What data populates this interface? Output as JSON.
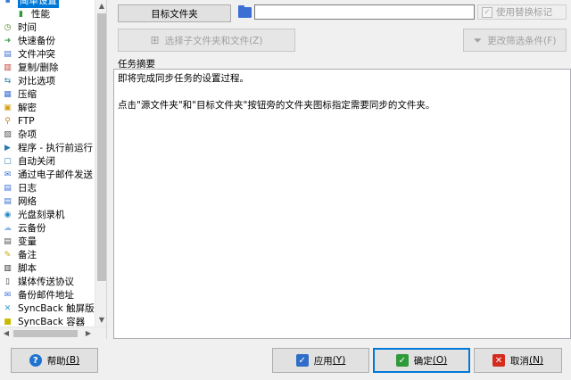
{
  "sidebar": {
    "items": [
      {
        "label": "简单设置",
        "icon": "settings-icon",
        "color": "#3a7bd5",
        "glyph": "▪",
        "selected": true,
        "sub": false
      },
      {
        "label": "性能",
        "icon": "bar-chart-icon",
        "color": "#2e9a3a",
        "glyph": "▮",
        "selected": false,
        "sub": true
      },
      {
        "label": "时间",
        "icon": "time-icon",
        "color": "#4a8a2a",
        "glyph": "◷",
        "selected": false,
        "sub": false
      },
      {
        "label": "快速备份",
        "icon": "fast-backup-icon",
        "color": "#3aa04a",
        "glyph": "➜",
        "selected": false,
        "sub": false
      },
      {
        "label": "文件冲突",
        "icon": "file-conflict-icon",
        "color": "#3b6fd6",
        "glyph": "▤",
        "selected": false,
        "sub": false
      },
      {
        "label": "复制/删除",
        "icon": "copy-delete-icon",
        "color": "#c0392b",
        "glyph": "▥",
        "selected": false,
        "sub": false
      },
      {
        "label": "对比选项",
        "icon": "compare-icon",
        "color": "#2a7ab0",
        "glyph": "⇆",
        "selected": false,
        "sub": false
      },
      {
        "label": "压缩",
        "icon": "compress-icon",
        "color": "#3b6fd6",
        "glyph": "▦",
        "selected": false,
        "sub": false
      },
      {
        "label": "解密",
        "icon": "lock-icon",
        "color": "#d4a017",
        "glyph": "▣",
        "selected": false,
        "sub": false
      },
      {
        "label": "FTP",
        "icon": "ftp-icon",
        "color": "#c77d14",
        "glyph": "⚲",
        "selected": false,
        "sub": false
      },
      {
        "label": "杂项",
        "icon": "misc-icon",
        "color": "#555555",
        "glyph": "▧",
        "selected": false,
        "sub": false
      },
      {
        "label": "程序 - 执行前运行",
        "icon": "program-run-icon",
        "color": "#2a7ab0",
        "glyph": "▶",
        "selected": false,
        "sub": false
      },
      {
        "label": "自动关闭",
        "icon": "auto-close-icon",
        "color": "#2a7ab0",
        "glyph": "▢",
        "selected": false,
        "sub": false
      },
      {
        "label": "通过电子邮件发送",
        "icon": "email-icon",
        "color": "#3b6fd6",
        "glyph": "✉",
        "selected": false,
        "sub": false
      },
      {
        "label": "日志",
        "icon": "log-icon",
        "color": "#3b6fd6",
        "glyph": "▤",
        "selected": false,
        "sub": false
      },
      {
        "label": "网络",
        "icon": "network-icon",
        "color": "#3b6fd6",
        "glyph": "▤",
        "selected": false,
        "sub": false
      },
      {
        "label": "光盘刻录机",
        "icon": "disc-burner-icon",
        "color": "#2a8ac0",
        "glyph": "◉",
        "selected": false,
        "sub": false
      },
      {
        "label": "云备份",
        "icon": "cloud-backup-icon",
        "color": "#8fb8e8",
        "glyph": "☁",
        "selected": false,
        "sub": false
      },
      {
        "label": "变量",
        "icon": "variables-icon",
        "color": "#555555",
        "glyph": "▤",
        "selected": false,
        "sub": false
      },
      {
        "label": "备注",
        "icon": "notes-icon",
        "color": "#c9a400",
        "glyph": "✎",
        "selected": false,
        "sub": false
      },
      {
        "label": "脚本",
        "icon": "script-icon",
        "color": "#333333",
        "glyph": "▥",
        "selected": false,
        "sub": false
      },
      {
        "label": "媒体传送协议",
        "icon": "media-transfer-icon",
        "color": "#333333",
        "glyph": "▯",
        "selected": false,
        "sub": false
      },
      {
        "label": "备份邮件地址",
        "icon": "email-address-icon",
        "color": "#3b6fd6",
        "glyph": "✉",
        "selected": false,
        "sub": false
      },
      {
        "label": "SyncBack 触屏版",
        "icon": "touch-icon",
        "color": "#2a9ad0",
        "glyph": "✕",
        "selected": false,
        "sub": false
      },
      {
        "label": "SyncBack 容器",
        "icon": "container-icon",
        "color": "#c9b800",
        "glyph": "■",
        "selected": false,
        "sub": false
      }
    ]
  },
  "toolbar": {
    "dest_button_label": "目标文件夹",
    "dest_input_value": "",
    "replace_marker_label": "使用替换标记",
    "subfolder_button_label": "选择子文件夹和文件(Z)",
    "filter_button_label": "更改筛选条件(F)"
  },
  "summary": {
    "label": "任务摘要",
    "line1": "即将完成同步任务的设置过程。",
    "line2": "点击\"源文件夹\"和\"目标文件夹\"按钮旁的文件夹图标指定需要同步的文件夹。"
  },
  "buttons": {
    "help": {
      "text": "帮助",
      "key": "(B)"
    },
    "apply": {
      "text": "应用",
      "key": "(Y)"
    },
    "ok": {
      "text": "确定",
      "key": "(O)"
    },
    "cancel": {
      "text": "取消",
      "key": "(N)"
    }
  },
  "colors": {
    "selection": "#0078d7",
    "ok_border": "#0078d7",
    "cancel_icon": "#d52b1e",
    "ok_icon": "#2e9a3a",
    "help_icon": "#1e73d0"
  }
}
